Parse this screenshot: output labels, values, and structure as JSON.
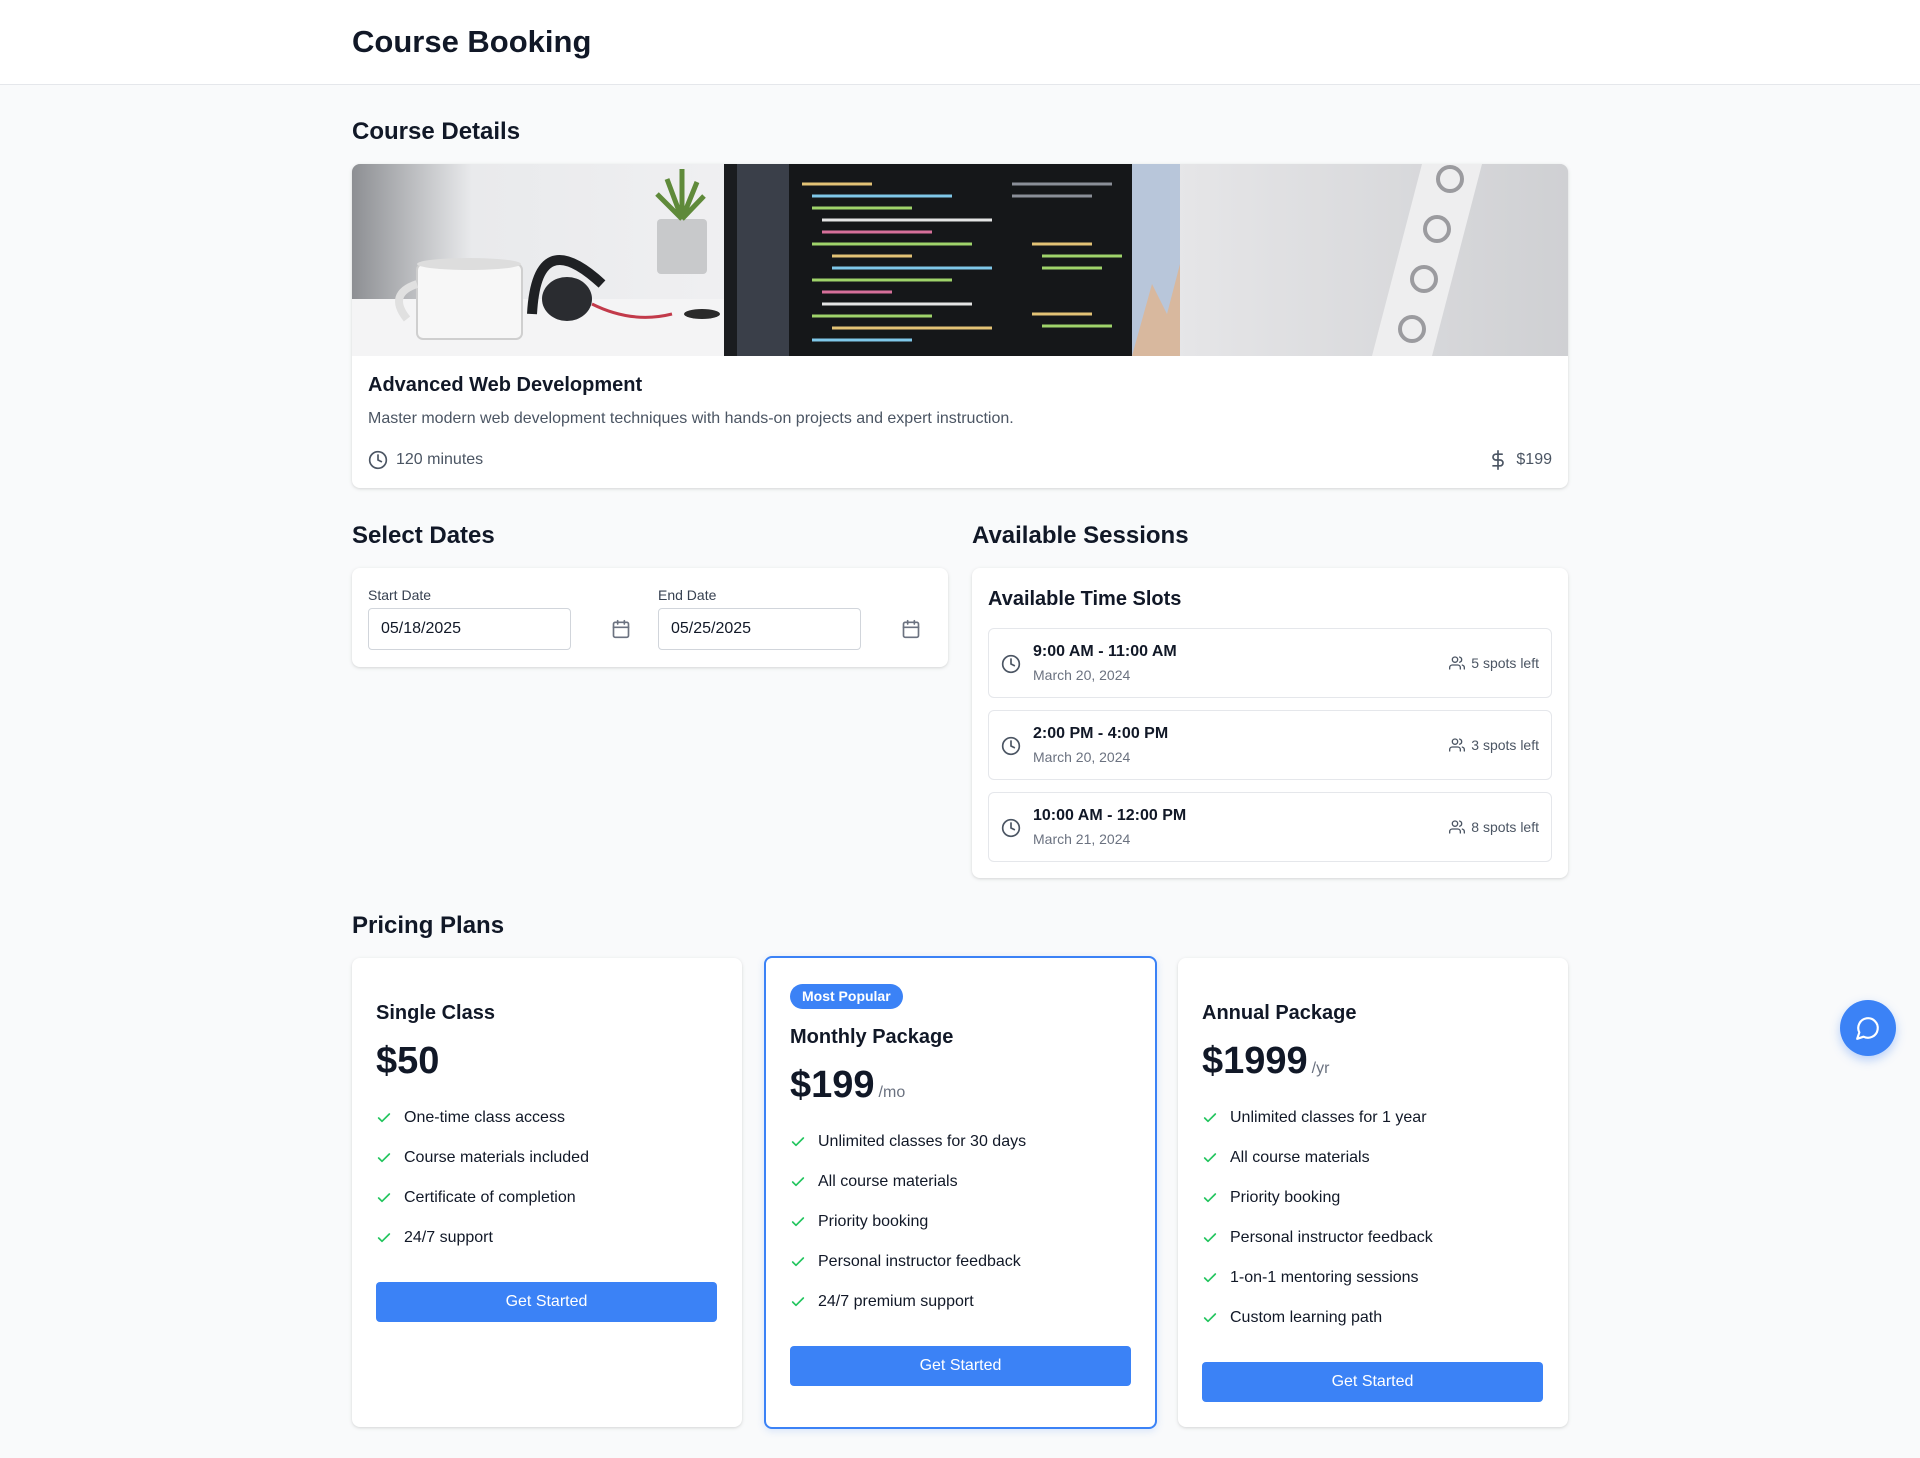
{
  "header": {
    "title": "Course Booking"
  },
  "course_details": {
    "section_title": "Course Details",
    "name": "Advanced Web Development",
    "description": "Master modern web development techniques with hands-on projects and expert instruction.",
    "duration": "120 minutes",
    "price": "$199"
  },
  "dates": {
    "section_title": "Select Dates",
    "start_label": "Start Date",
    "start_value": "05/18/2025",
    "end_label": "End Date",
    "end_value": "05/25/2025"
  },
  "sessions": {
    "section_title": "Available Sessions",
    "card_title": "Available Time Slots",
    "slots": [
      {
        "time": "9:00 AM - 11:00 AM",
        "date": "March 20, 2024",
        "spots": "5 spots left"
      },
      {
        "time": "2:00 PM - 4:00 PM",
        "date": "March 20, 2024",
        "spots": "3 spots left"
      },
      {
        "time": "10:00 AM - 12:00 PM",
        "date": "March 21, 2024",
        "spots": "8 spots left"
      }
    ]
  },
  "pricing": {
    "section_title": "Pricing Plans",
    "plans": [
      {
        "name": "Single Class",
        "price": "$50",
        "period": "",
        "badge": "",
        "features": [
          "One-time class access",
          "Course materials included",
          "Certificate of completion",
          "24/7 support"
        ],
        "cta": "Get Started"
      },
      {
        "name": "Monthly Package",
        "price": "$199",
        "period": "/mo",
        "badge": "Most Popular",
        "features": [
          "Unlimited classes for 30 days",
          "All course materials",
          "Priority booking",
          "Personal instructor feedback",
          "24/7 premium support"
        ],
        "cta": "Get Started"
      },
      {
        "name": "Annual Package",
        "price": "$1999",
        "period": "/yr",
        "badge": "",
        "features": [
          "Unlimited classes for 1 year",
          "All course materials",
          "Priority booking",
          "Personal instructor feedback",
          "1-on-1 mentoring sessions",
          "Custom learning path"
        ],
        "cta": "Get Started"
      }
    ]
  },
  "colors": {
    "accent": "#3b82f6",
    "check": "#22c55e",
    "page_bg": "#f9fafb"
  },
  "icons": {
    "duration": "clock-icon",
    "price": "dollar-icon",
    "date_picker": "calendar-icon",
    "spots": "users-icon",
    "feature": "check-icon",
    "chat": "chat-icon"
  }
}
